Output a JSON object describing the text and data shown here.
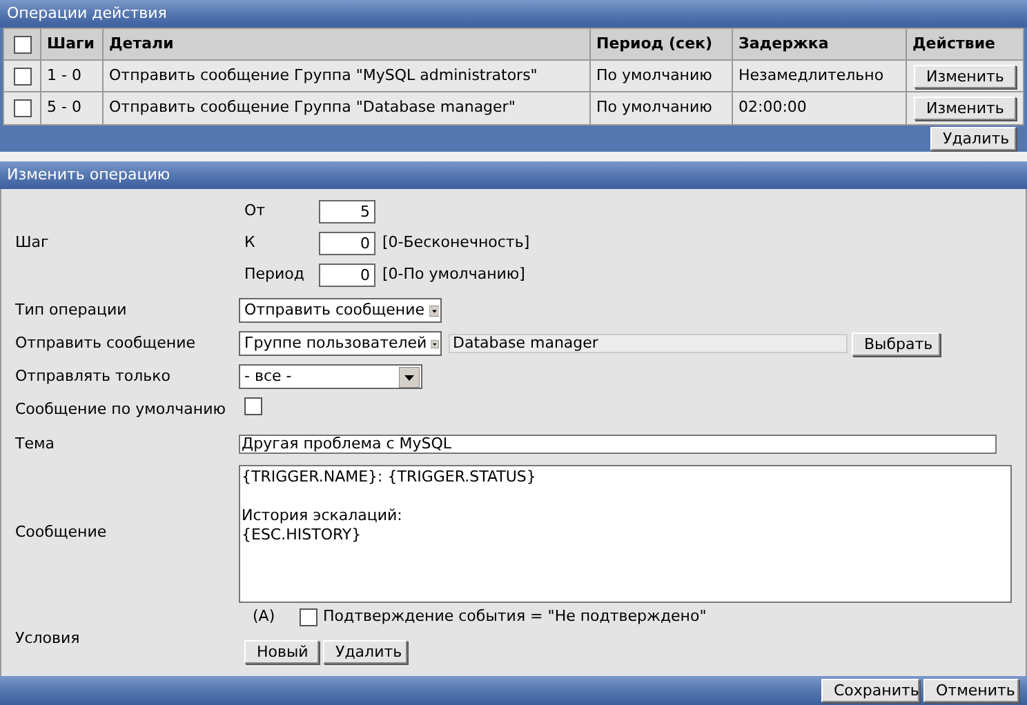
{
  "operations_panel": {
    "title": "Операции действия",
    "table": {
      "select_all_checked": false,
      "columns": [
        "Шаги",
        "Детали",
        "Период (сек)",
        "Задержка",
        "Действие"
      ],
      "rows": [
        {
          "checked": false,
          "steps": "1 - 0",
          "details": "Отправить сообщение Группа \"MySQL administrators\"",
          "period": "По умолчанию",
          "delay": "Незамедлительно",
          "action": "Изменить"
        },
        {
          "checked": false,
          "steps": "5 - 0",
          "details": "Отправить сообщение Группа \"Database manager\"",
          "period": "По умолчанию",
          "delay": "02:00:00",
          "action": "Изменить"
        }
      ]
    },
    "delete_button": "Удалить"
  },
  "edit_panel": {
    "title": "Изменить операцию",
    "step": {
      "label": "Шаг",
      "from_label": "От",
      "from": "5",
      "to_label": "К",
      "to": "0",
      "to_hint": "[0-Бесконечность]",
      "period_label": "Период",
      "period": "0",
      "period_hint": "[0-По умолчанию]"
    },
    "operation_type": {
      "label": "Тип операции",
      "value": "Отправить сообщение"
    },
    "send_message": {
      "label": "Отправить сообщение",
      "value": "Группе пользователей",
      "target": "Database manager",
      "select_button": "Выбрать"
    },
    "send_only": {
      "label": "Отправлять только",
      "value": "- все -"
    },
    "default_message": {
      "label": "Сообщение по умолчанию",
      "checked": false
    },
    "subject": {
      "label": "Тема",
      "value": "Другая проблема с MySQL"
    },
    "message": {
      "label": "Сообщение",
      "value": "{TRIGGER.NAME}: {TRIGGER.STATUS}\n\nИстория эскалаций:\n{ESC.HISTORY}"
    },
    "conditions": {
      "label": "Условия",
      "items": [
        {
          "tag": "(A)",
          "checked": false,
          "text": "Подтверждение события = \"Не подтверждено\""
        }
      ],
      "new_button": "Новый",
      "delete_button": "Удалить"
    },
    "save_button": "Сохранить",
    "cancel_button": "Отменить"
  }
}
